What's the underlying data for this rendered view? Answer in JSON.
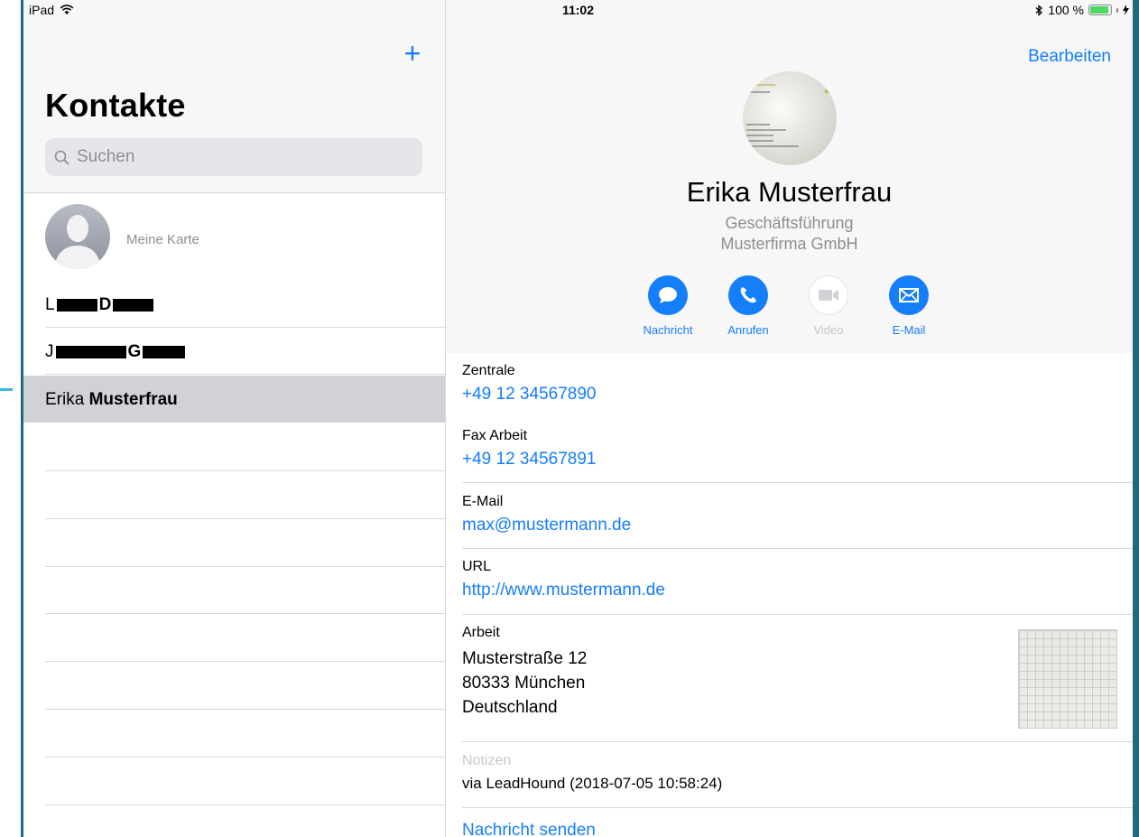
{
  "status": {
    "device": "iPad",
    "time": "11:02",
    "battery": "100 %",
    "battery_level": 1.0
  },
  "left": {
    "title": "Kontakte",
    "search_placeholder": "Suchen",
    "my_card_label": "Meine Karte",
    "contacts": [
      {
        "first_initial": "L",
        "last_initial": "D"
      },
      {
        "first_initial": "J",
        "last_initial": "G"
      },
      {
        "first": "Erika",
        "last": "Musterfrau"
      }
    ]
  },
  "right": {
    "edit": "Bearbeiten",
    "name": "Erika Musterfrau",
    "job_title": "Geschäftsführung",
    "company": "Musterfirma GmbH",
    "actions": [
      {
        "label": "Nachricht",
        "icon": "message-icon",
        "enabled": true
      },
      {
        "label": "Anrufen",
        "icon": "phone-icon",
        "enabled": true
      },
      {
        "label": "Video",
        "icon": "video-icon",
        "enabled": false
      },
      {
        "label": "E-Mail",
        "icon": "mail-icon",
        "enabled": true
      }
    ],
    "fields": {
      "phone_label": "Zentrale",
      "phone_value": "+49 12 34567890",
      "fax_label": "Fax Arbeit",
      "fax_value": "+49 12 34567891",
      "email_label": "E-Mail",
      "email_value": "max@mustermann.de",
      "url_label": "URL",
      "url_value": "http://www.mustermann.de",
      "address_label": "Arbeit",
      "address_lines": [
        "Musterstraße 12",
        "80333 München",
        "Deutschland"
      ],
      "notes_label": "Notizen",
      "notes_value": "via LeadHound (2018-07-05 10:58:24)",
      "send_message": "Nachricht senden"
    }
  },
  "colors": {
    "accent": "#147efb",
    "selected_row": "#d1d1d6",
    "header_bg": "#f7f7f7",
    "secondary_text": "#8e8e93"
  }
}
